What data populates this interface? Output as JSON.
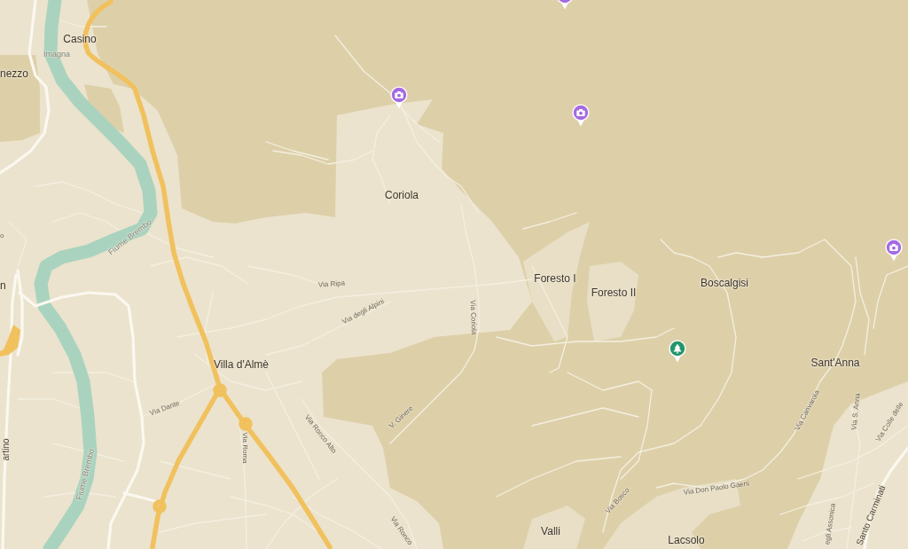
{
  "map": {
    "labels": [
      {
        "kind": "place",
        "text": "Casino"
      },
      {
        "kind": "water",
        "text": "Imagna"
      },
      {
        "kind": "place",
        "text": "nezzo"
      },
      {
        "kind": "place",
        "text": "Coriola"
      },
      {
        "kind": "street",
        "text": "o"
      },
      {
        "kind": "water",
        "text": "Fiume Brembo"
      },
      {
        "kind": "place",
        "text": "Boscalgisi"
      },
      {
        "kind": "place",
        "text": "Foresto I"
      },
      {
        "kind": "street",
        "text": "Via Ripa"
      },
      {
        "kind": "place",
        "text": "n"
      },
      {
        "kind": "place",
        "text": "Foresto II"
      },
      {
        "kind": "street",
        "text": "Via degli Alpini"
      },
      {
        "kind": "street",
        "text": "Via Coriola"
      },
      {
        "kind": "place",
        "text": "Sant'Anna"
      },
      {
        "kind": "place",
        "text": "Villa d'Almè"
      },
      {
        "kind": "street",
        "text": "Via Dante"
      },
      {
        "kind": "street",
        "text": "Via Canvarola"
      },
      {
        "kind": "street",
        "text": "Via S. Anna"
      },
      {
        "kind": "street",
        "text": "Via Colle delle"
      },
      {
        "kind": "street",
        "text": "V. Ginere"
      },
      {
        "kind": "road",
        "text": "artino"
      },
      {
        "kind": "street",
        "text": "Via Ronco Alto"
      },
      {
        "kind": "street",
        "text": "Via Roma"
      },
      {
        "kind": "water",
        "text": "Fiume Brembo"
      },
      {
        "kind": "street",
        "text": "Via Don Paolo Gaeni"
      },
      {
        "kind": "street",
        "text": "Via Bosco"
      },
      {
        "kind": "street",
        "text": "egli Assonica"
      },
      {
        "kind": "road",
        "text": "Santo Carminati"
      },
      {
        "kind": "place",
        "text": "Valli"
      },
      {
        "kind": "street",
        "text": "Via Ronco"
      },
      {
        "kind": "place",
        "text": "Lacsolo"
      }
    ],
    "pins": [
      {
        "kind": "camera"
      },
      {
        "kind": "camera"
      },
      {
        "kind": "camera"
      },
      {
        "kind": "camera"
      },
      {
        "kind": "tree"
      }
    ]
  }
}
